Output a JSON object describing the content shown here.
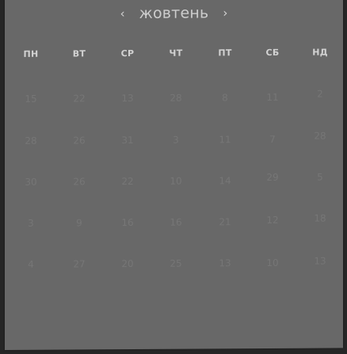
{
  "header": {
    "prev_label": "‹",
    "month_label": "жовтень",
    "next_label": "›"
  },
  "weekdays": [
    "ПН",
    "ВТ",
    "СР",
    "ЧТ",
    "ПТ",
    "СБ",
    "НД"
  ],
  "weeks": [
    [
      "15",
      "22",
      "13",
      "28",
      "8",
      "11",
      "2"
    ],
    [
      "28",
      "26",
      "31",
      "3",
      "11",
      "7",
      "28"
    ],
    [
      "30",
      "26",
      "22",
      "10",
      "14",
      "29",
      "5"
    ],
    [
      "3",
      "9",
      "16",
      "16",
      "21",
      "12",
      "18"
    ],
    [
      "4",
      "27",
      "20",
      "25",
      "13",
      "10",
      "13"
    ]
  ],
  "colors": {
    "background": "#262626",
    "panel": "#686868",
    "header_text": "#cdcdcd",
    "weekday_text": "#d2d2d2",
    "day_text": "#767676"
  }
}
